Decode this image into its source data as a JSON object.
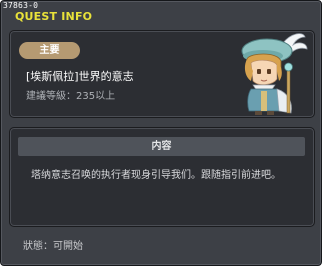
{
  "window": {
    "quest_id": "37863-0",
    "title": "QUEST INFO"
  },
  "header": {
    "badge": "主要",
    "quest_name": "[埃斯佩拉]世界的意志",
    "recommended_level": "建議等級：235以上"
  },
  "content": {
    "section_title": "内容",
    "text": "塔纳意志召唤的执行者现身引导我们。跟随指引前进吧。"
  },
  "footer": {
    "status": "狀態：可開始"
  },
  "colors": {
    "title": "#e9e23a",
    "badge": "#b59a72",
    "panel": "#2c2e33",
    "window": "#3d4046"
  }
}
